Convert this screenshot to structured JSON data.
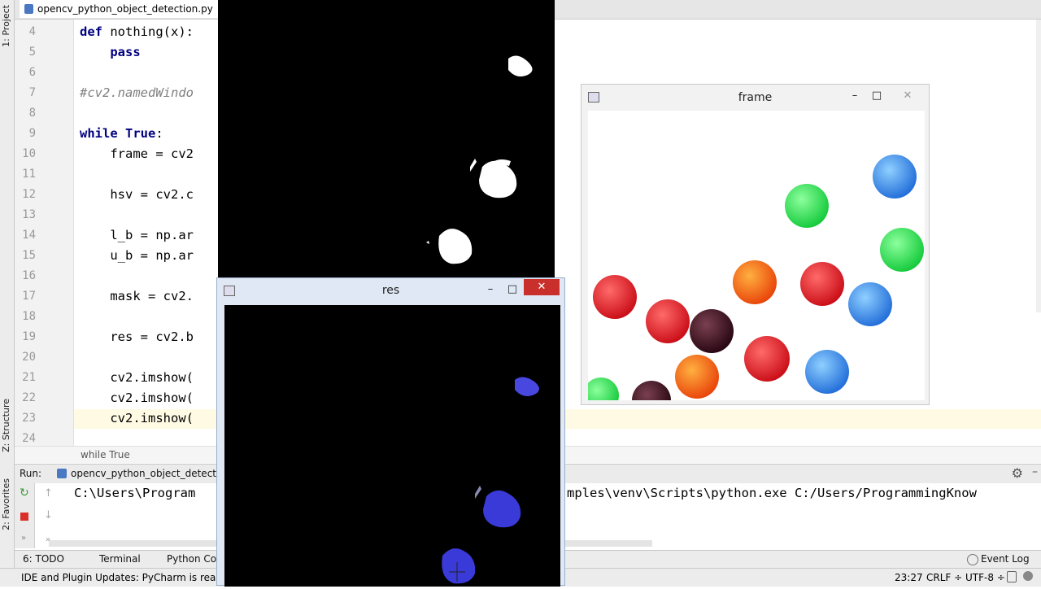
{
  "editor": {
    "tab_label": "opencv_python_object_detection.py",
    "lines": [
      {
        "n": "4",
        "segments": [
          {
            "t": "def ",
            "c": "kw"
          },
          {
            "t": "nothing(x):",
            "c": ""
          }
        ]
      },
      {
        "n": "5",
        "segments": [
          {
            "t": "    ",
            "c": ""
          },
          {
            "t": "pass",
            "c": "kw"
          }
        ]
      },
      {
        "n": "6",
        "segments": []
      },
      {
        "n": "7",
        "segments": [
          {
            "t": "#cv2.namedWindo",
            "c": "cmt"
          }
        ]
      },
      {
        "n": "8",
        "segments": []
      },
      {
        "n": "9",
        "segments": [
          {
            "t": "while True",
            "c": "kw"
          },
          {
            "t": ":",
            "c": ""
          }
        ]
      },
      {
        "n": "10",
        "segments": [
          {
            "t": "    frame = cv2",
            "c": ""
          }
        ]
      },
      {
        "n": "11",
        "segments": []
      },
      {
        "n": "12",
        "segments": [
          {
            "t": "    hsv = cv2.c",
            "c": ""
          }
        ]
      },
      {
        "n": "13",
        "segments": []
      },
      {
        "n": "14",
        "segments": [
          {
            "t": "    l_b = np.ar",
            "c": ""
          }
        ]
      },
      {
        "n": "15",
        "segments": [
          {
            "t": "    u_b = np.ar",
            "c": ""
          }
        ]
      },
      {
        "n": "16",
        "segments": []
      },
      {
        "n": "17",
        "segments": [
          {
            "t": "    mask = cv2.",
            "c": ""
          }
        ]
      },
      {
        "n": "18",
        "segments": []
      },
      {
        "n": "19",
        "segments": [
          {
            "t": "    res = cv2.b",
            "c": ""
          }
        ]
      },
      {
        "n": "20",
        "segments": []
      },
      {
        "n": "21",
        "segments": [
          {
            "t": "    cv2.imshow(",
            "c": ""
          }
        ]
      },
      {
        "n": "22",
        "segments": [
          {
            "t": "    cv2.imshow(",
            "c": ""
          }
        ]
      },
      {
        "n": "23",
        "segments": [
          {
            "t": "    cv2.imshow(",
            "c": ""
          }
        ]
      },
      {
        "n": "24",
        "segments": []
      }
    ],
    "breadcrumb": "while True"
  },
  "left_strip": {
    "project": "1: Project",
    "structure": "Z: Structure",
    "favorites": "2: Favorites"
  },
  "run_panel": {
    "label": "Run:",
    "config": "opencv_python_object_detection",
    "cmd_left": "C:\\Users\\Program",
    "cmd_right": "mples\\venv\\Scripts\\python.exe C:/Users/ProgrammingKnow"
  },
  "bottom_tabs": {
    "todo": "6: TODO",
    "terminal": "Terminal",
    "python_console": "Python Con",
    "event_log": "Event Log"
  },
  "status": {
    "message": "IDE and Plugin Updates: PyCharm is ready to",
    "position": "23:27",
    "line_sep": "CRLF ÷",
    "encoding": "UTF-8 ÷"
  },
  "windows": {
    "res_title": "res",
    "frame_title": "frame"
  },
  "colors": {
    "ball_red": "#e0101a",
    "ball_green": "#1ee64a",
    "ball_blue": "#2e7fe8",
    "ball_orange": "#f25a0a",
    "ball_maroon": "#3a0a14",
    "mask_blue": "#3a3ae0"
  }
}
